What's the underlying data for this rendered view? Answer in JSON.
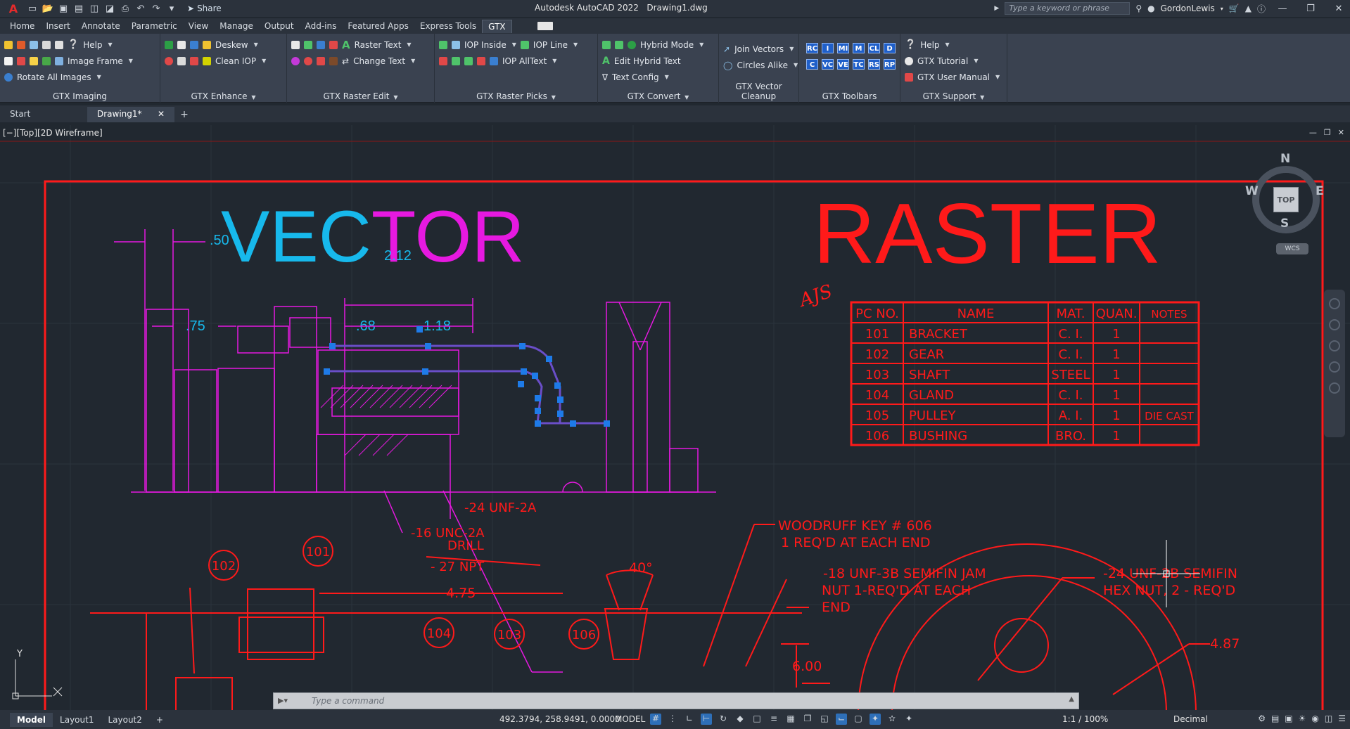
{
  "window": {
    "app_title": "Autodesk AutoCAD 2022",
    "document": "Drawing1.dwg",
    "share_label": "Share",
    "search_placeholder": "Type a keyword or phrase",
    "user": "GordonLewis"
  },
  "menu": {
    "tabs": [
      "Home",
      "Insert",
      "Annotate",
      "Parametric",
      "View",
      "Manage",
      "Output",
      "Add-ins",
      "Featured Apps",
      "Express Tools",
      "GTX"
    ],
    "active": "GTX"
  },
  "ribbon": {
    "imaging": {
      "title": "GTX Imaging",
      "help": "Help",
      "image_frame": "Image Frame",
      "rotate_all": "Rotate All Images"
    },
    "enhance": {
      "title": "GTX Enhance",
      "deskew": "Deskew",
      "clean_iop": "Clean IOP"
    },
    "raster_edit": {
      "title": "GTX Raster Edit",
      "raster_text": "Raster Text",
      "change_text": "Change Text"
    },
    "raster_picks": {
      "title": "GTX Raster Picks",
      "iop_inside": "IOP Inside",
      "iop_line": "IOP Line",
      "iop_alltext": "IOP AllText"
    },
    "convert": {
      "title": "GTX Convert",
      "hybrid_mode": "Hybrid Mode",
      "edit_hybrid": "Edit Hybrid Text",
      "text_config": "Text Config"
    },
    "vector_cleanup": {
      "title": "GTX Vector Cleanup",
      "join_vectors": "Join Vectors",
      "circles_alike": "Circles Alike"
    },
    "toolbars": {
      "title": "GTX Toolbars",
      "row1": [
        "RC",
        "I",
        "MI",
        "M",
        "CL",
        "D"
      ],
      "row2": [
        "C",
        "VC",
        "VE",
        "TC",
        "RS",
        "RP"
      ]
    },
    "support": {
      "title": "GTX Support",
      "help": "Help",
      "tutorial": "GTX Tutorial",
      "manual": "GTX User Manual"
    }
  },
  "file_tabs": {
    "start": "Start",
    "drawing": "Drawing1*"
  },
  "viewport": {
    "label": "[−][Top][2D Wireframe]",
    "viewcube": {
      "n": "N",
      "s": "S",
      "e": "E",
      "w": "W",
      "face": "TOP",
      "wcs": "WCS"
    },
    "ucs": {
      "y": "Y"
    }
  },
  "drawing": {
    "vector_heading": {
      "chars": [
        "V",
        "E",
        "C",
        "T",
        "O",
        "R"
      ],
      "colors": [
        "#17b9ec",
        "#17b9ec",
        "#17b9ec",
        "#e619e0",
        "#e619e0",
        "#e619e0"
      ]
    },
    "raster_heading": "RASTER",
    "dims_vector": [
      ".50",
      ".75",
      "2.12",
      ".68",
      "1.18"
    ],
    "callouts": [
      "-24 UNF-2A",
      "-16 UNC-2A",
      "DRILL",
      "- 27 NPT"
    ],
    "parts_table": {
      "headers": [
        "PC NO.",
        "NAME",
        "MAT.",
        "QUAN.",
        "NOTES"
      ],
      "rows": [
        [
          "101",
          "BRACKET",
          "C. I.",
          "1",
          ""
        ],
        [
          "102",
          "GEAR",
          "C. I.",
          "1",
          ""
        ],
        [
          "103",
          "SHAFT",
          "STEEL",
          "1",
          ""
        ],
        [
          "104",
          "GLAND",
          "C. I.",
          "1",
          ""
        ],
        [
          "105",
          "PULLEY",
          "A. I.",
          "1",
          "DIE CAST"
        ],
        [
          "106",
          "BUSHING",
          "BRO.",
          "1",
          ""
        ]
      ]
    },
    "initials": "AJS",
    "notes": {
      "woodruff": [
        "WOODRUFF  KEY # 606",
        "1 REQ'D  AT EACH  END"
      ],
      "jam": [
        "-18 UNF-3B  SEMIFIN  JAM",
        "NUT 1-REQ'D  AT EACH",
        "END"
      ],
      "hex": [
        "-24 UNF-2B  SEMIFIN",
        "HEX  NUT, 2 - REQ'D"
      ]
    },
    "balloons": [
      "102",
      "101",
      "104",
      "103",
      "106"
    ],
    "dims_raster": [
      "40°",
      "4.75",
      "6.00",
      "4.87"
    ],
    "colors": {
      "raster": "#ff1a1a",
      "cyan": "#17b9ec",
      "magenta": "#e619e0",
      "grip": "#1e7be8",
      "selected": "#6a4ec8"
    }
  },
  "command": {
    "placeholder": "Type  a  command"
  },
  "status": {
    "layouts": [
      "Model",
      "Layout1",
      "Layout2"
    ],
    "coords": "492.3794, 258.9491, 0.0000",
    "space": "MODEL",
    "scale": "1:1 / 100%",
    "units": "Decimal"
  }
}
